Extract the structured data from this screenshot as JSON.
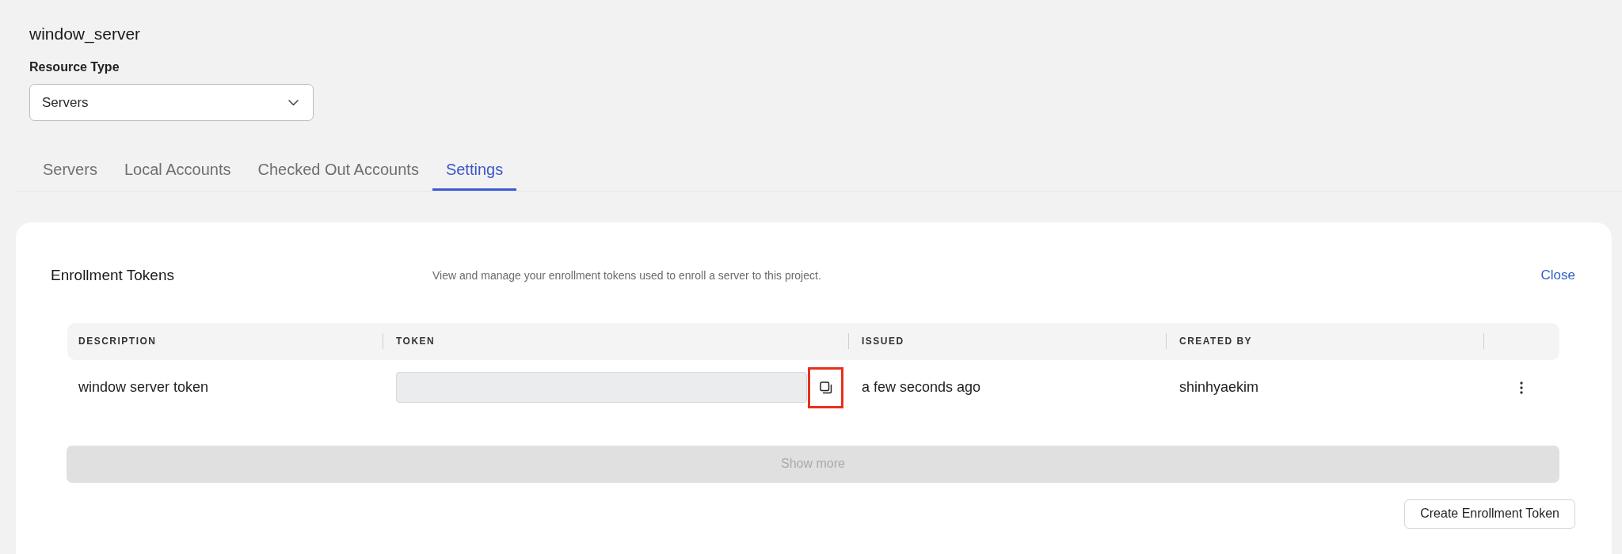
{
  "page": {
    "title": "window_server"
  },
  "resource_type": {
    "label": "Resource Type",
    "value": "Servers"
  },
  "tabs": [
    {
      "label": "Servers",
      "selected": false
    },
    {
      "label": "Local Accounts",
      "selected": false
    },
    {
      "label": "Checked Out Accounts",
      "selected": false
    },
    {
      "label": "Settings",
      "selected": true
    }
  ],
  "enrollment_tokens": {
    "title": "Enrollment Tokens",
    "description": "View and manage your enrollment tokens used to enroll a server to this project.",
    "close_link": "Close",
    "table": {
      "columns": [
        "DESCRIPTION",
        "TOKEN",
        "ISSUED",
        "CREATED BY"
      ],
      "rows": [
        {
          "description": "window server token",
          "copy_highlighted": true,
          "issued": "a few seconds ago",
          "created_by": "shinhyaekim"
        }
      ]
    },
    "show_more": {
      "label": "Show more",
      "disabled": true
    },
    "create_button": "Create Enrollment Token"
  }
}
